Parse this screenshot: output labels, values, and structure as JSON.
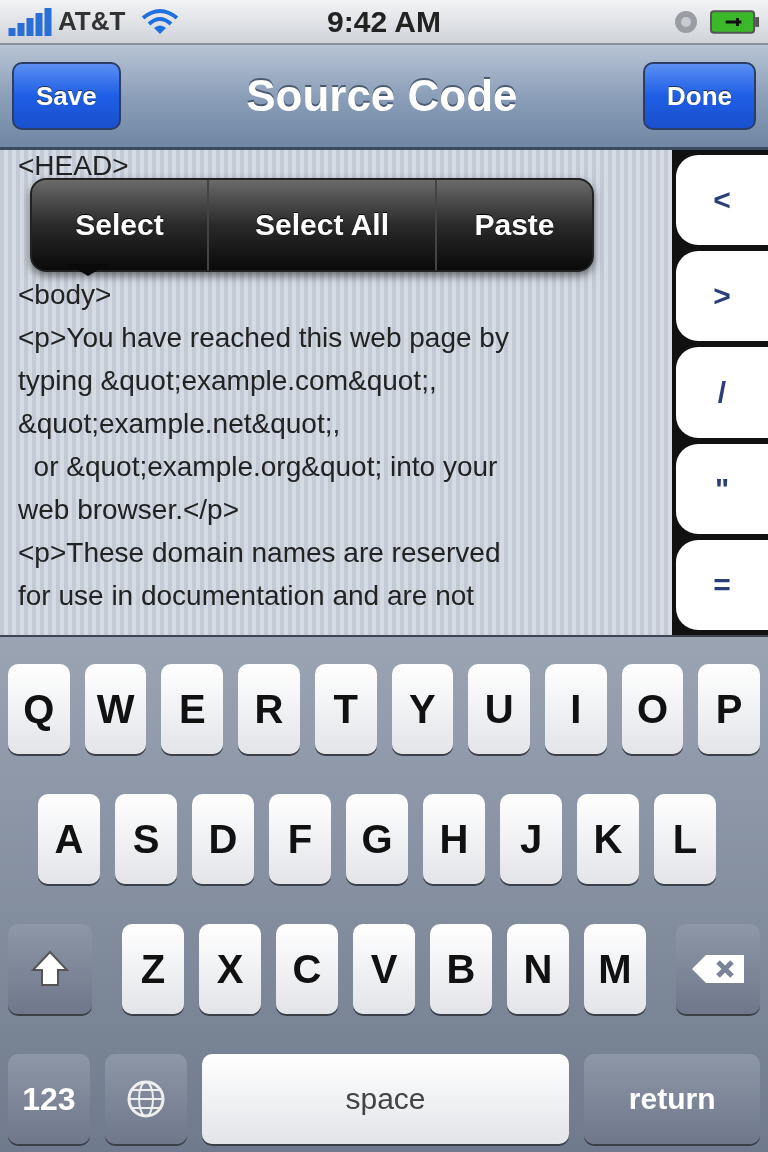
{
  "status_bar": {
    "carrier": "AT&T",
    "time": "9:42 AM"
  },
  "nav_bar": {
    "left_button": "Save",
    "title": "Source Code",
    "right_button": "Done"
  },
  "editor": {
    "lines_above_menu": [
      "<HEAD>"
    ],
    "lines": [
      "<body>",
      "<p>You have reached this web page by",
      "typing &quot;example.com&quot;,",
      "&quot;example.net&quot;,",
      "  or &quot;example.org&quot; into your",
      "web browser.</p>",
      "<p>These domain names are reserved",
      "for use in documentation and are not"
    ]
  },
  "context_menu": {
    "items": [
      "Select",
      "Select All",
      "Paste"
    ]
  },
  "side_keys": [
    "<",
    ">",
    "/",
    "\"",
    "="
  ],
  "keyboard": {
    "rows": [
      {
        "keys": [
          {
            "kind": "letter",
            "label": "Q"
          },
          {
            "kind": "letter",
            "label": "W"
          },
          {
            "kind": "letter",
            "label": "E"
          },
          {
            "kind": "letter",
            "label": "R"
          },
          {
            "kind": "letter",
            "label": "T"
          },
          {
            "kind": "letter",
            "label": "Y"
          },
          {
            "kind": "letter",
            "label": "U"
          },
          {
            "kind": "letter",
            "label": "I"
          },
          {
            "kind": "letter",
            "label": "O"
          },
          {
            "kind": "letter",
            "label": "P"
          }
        ]
      },
      {
        "keys": [
          {
            "kind": "letter",
            "label": "A"
          },
          {
            "kind": "letter",
            "label": "S"
          },
          {
            "kind": "letter",
            "label": "D"
          },
          {
            "kind": "letter",
            "label": "F"
          },
          {
            "kind": "letter",
            "label": "G"
          },
          {
            "kind": "letter",
            "label": "H"
          },
          {
            "kind": "letter",
            "label": "J"
          },
          {
            "kind": "letter",
            "label": "K"
          },
          {
            "kind": "letter",
            "label": "L"
          }
        ]
      },
      {
        "keys": [
          {
            "kind": "shift"
          },
          {
            "kind": "letter",
            "label": "Z"
          },
          {
            "kind": "letter",
            "label": "X"
          },
          {
            "kind": "letter",
            "label": "C"
          },
          {
            "kind": "letter",
            "label": "V"
          },
          {
            "kind": "letter",
            "label": "B"
          },
          {
            "kind": "letter",
            "label": "N"
          },
          {
            "kind": "letter",
            "label": "M"
          },
          {
            "kind": "delete"
          }
        ]
      },
      {
        "keys": [
          {
            "kind": "numbers",
            "label": "123"
          },
          {
            "kind": "globe"
          },
          {
            "kind": "space",
            "label": "space"
          },
          {
            "kind": "return",
            "label": "return"
          }
        ]
      }
    ]
  }
}
